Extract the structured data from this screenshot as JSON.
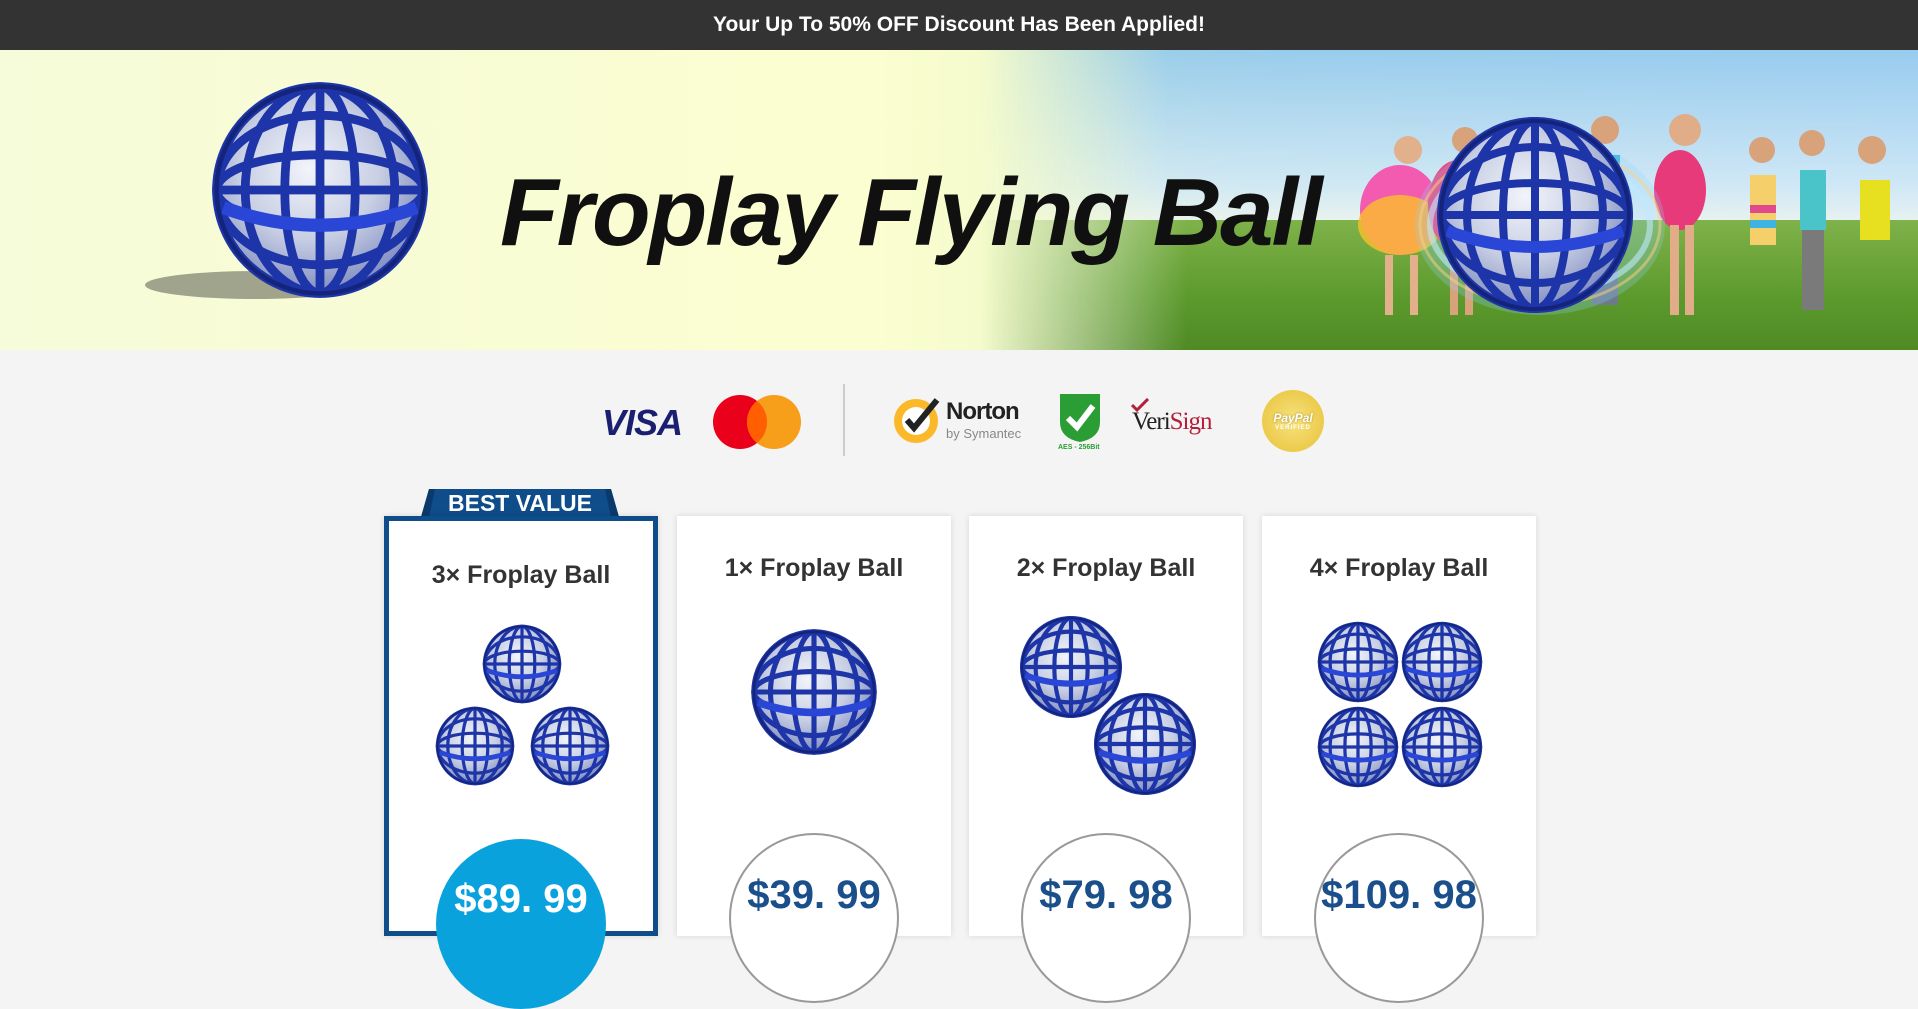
{
  "topbar": {
    "text": "Your Up To 50% OFF Discount Has Been Applied!"
  },
  "banner": {
    "title": "Froplay Flying Ball"
  },
  "trust": {
    "visa": "VISA",
    "norton": "Norton",
    "norton_sub": "by Symantec",
    "aes": "AES - 256Bit",
    "verisign_a": "Veri",
    "verisign_b": "Sign",
    "paypal": "PayPal",
    "paypal_sub": "VERIFIED"
  },
  "offers": [
    {
      "ribbon": "BEST VALUE",
      "title": "3× Froplay Ball",
      "price": "$89. 99"
    },
    {
      "title": "1× Froplay Ball",
      "price": "$39. 99"
    },
    {
      "title": "2× Froplay Ball",
      "price": "$79. 98"
    },
    {
      "title": "4× Froplay Ball",
      "price": "$109. 98"
    }
  ],
  "colors": {
    "brand_blue": "#0e4c8a",
    "price_blue": "#1a4f8b",
    "best_price_fill": "#0aa2dc",
    "topbar_bg": "#333333"
  }
}
